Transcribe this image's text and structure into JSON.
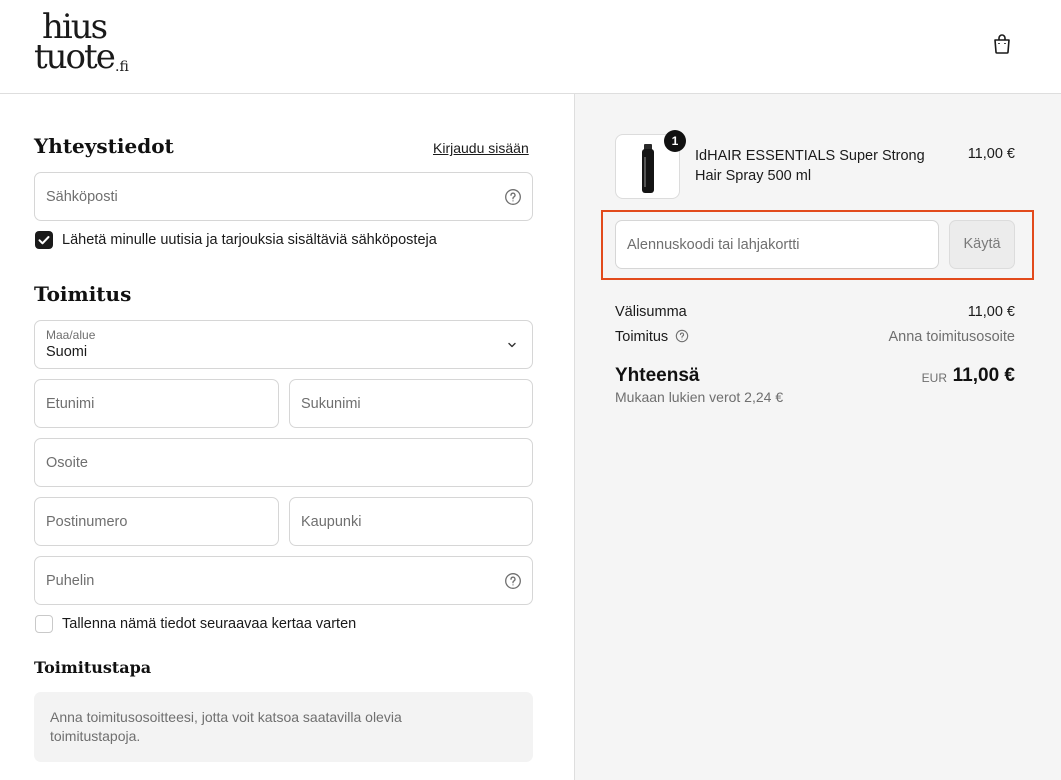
{
  "header": {
    "logo_line1": "hius",
    "logo_line2": "tuote",
    "logo_suffix": ".fi",
    "cart_icon": "shopping-bag-icon"
  },
  "contact": {
    "title": "Yhteystiedot",
    "login_link": "Kirjaudu sisään",
    "email_placeholder": "Sähköposti",
    "newsletter_label": "Lähetä minulle uutisia ja tarjouksia sisältäviä sähköposteja",
    "newsletter_checked": true
  },
  "delivery": {
    "title": "Toimitus",
    "country_label": "Maa/alue",
    "country_value": "Suomi",
    "first_name": "Etunimi",
    "last_name": "Sukunimi",
    "address": "Osoite",
    "postal_code": "Postinumero",
    "city": "Kaupunki",
    "phone": "Puhelin",
    "save_label": "Tallenna nämä tiedot seuraavaa kertaa varten",
    "save_checked": false
  },
  "shipping_method": {
    "title": "Toimitustapa",
    "notice": "Anna toimitusosoitteesi, jotta voit katsoa saatavilla olevia toimitustapoja."
  },
  "summary": {
    "product": {
      "name": "IdHAIR ESSENTIALS Super Strong Hair Spray 500 ml",
      "quantity": "1",
      "price": "11,00 €"
    },
    "discount_placeholder": "Alennuskoodi tai lahjakortti",
    "apply_label": "Käytä",
    "subtotal_label": "Välisumma",
    "subtotal_value": "11,00 €",
    "shipping_label": "Toimitus",
    "shipping_value": "Anna toimitusosoite",
    "total_label": "Yhteensä",
    "total_currency": "EUR",
    "total_value": "11,00 €",
    "tax_note": "Mukaan lukien verot 2,24 €"
  },
  "colors": {
    "highlight": "#e24a1c",
    "summary_bg": "#f5f5f5"
  }
}
